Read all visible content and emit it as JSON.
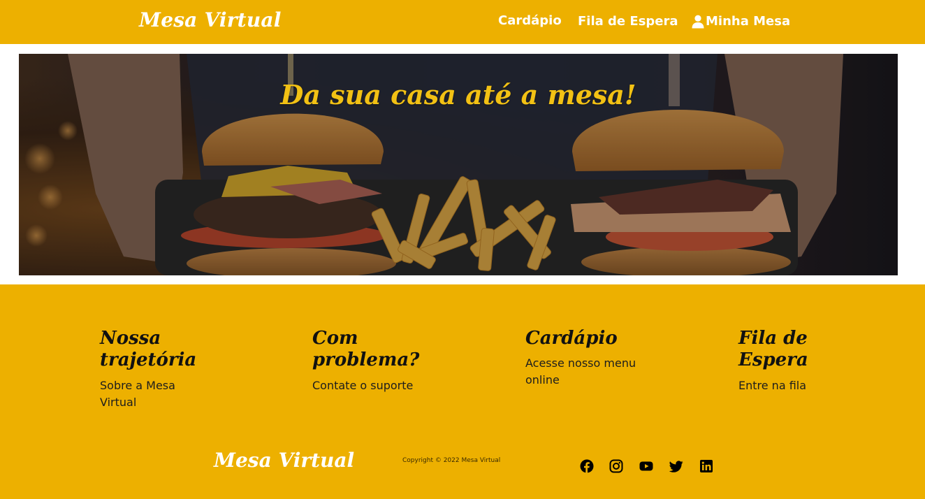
{
  "header": {
    "logo": "Mesa Virtual",
    "nav": {
      "cardapio": "Cardápio",
      "fila": "Fila de Espera",
      "mesa": "Minha Mesa"
    }
  },
  "hero": {
    "title": "Da sua casa até a mesa!"
  },
  "footer": {
    "columns": [
      {
        "title": "Nossa trajetória",
        "link": "Sobre a Mesa Virtual"
      },
      {
        "title": "Com problema?",
        "link": "Contate o suporte"
      },
      {
        "title": "Cardápio",
        "link": "Acesse nosso menu online"
      },
      {
        "title": "Fila de Espera",
        "link": "Entre na fila"
      }
    ],
    "logo": "Mesa Virtual",
    "copyright": "Copyright © 2022 Mesa Virtual",
    "social": [
      "facebook-icon",
      "instagram-icon",
      "youtube-icon",
      "twitter-icon",
      "linkedin-icon"
    ]
  },
  "colors": {
    "brand": "#edb000",
    "hero_title": "#f2c114",
    "text_white": "#ffffff"
  }
}
